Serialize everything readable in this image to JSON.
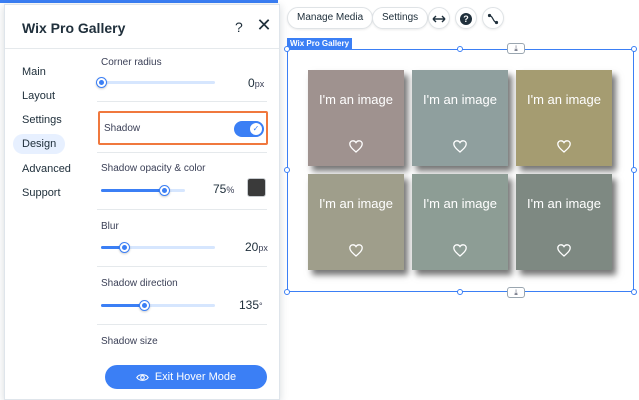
{
  "panel": {
    "title": "Wix Pro Gallery",
    "help_glyph": "?",
    "close_glyph": "✕",
    "nav": [
      {
        "label": "Main",
        "active": false
      },
      {
        "label": "Layout",
        "active": false
      },
      {
        "label": "Settings",
        "active": false
      },
      {
        "label": "Design",
        "active": true
      },
      {
        "label": "Advanced",
        "active": false
      },
      {
        "label": "Support",
        "active": false
      }
    ],
    "corner_radius": {
      "label": "Corner radius",
      "value": "0",
      "unit": "px",
      "fraction": 0.0
    },
    "shadow": {
      "label": "Shadow",
      "enabled": true
    },
    "shadow_opacity": {
      "label": "Shadow opacity & color",
      "value": "75",
      "unit": "%",
      "fraction": 0.75,
      "color": "#3a3a3a"
    },
    "blur": {
      "label": "Blur",
      "value": "20",
      "unit": "px",
      "fraction": 0.2
    },
    "shadow_direction": {
      "label": "Shadow direction",
      "value": "135",
      "unit": "°",
      "fraction": 0.375
    },
    "shadow_size": {
      "label": "Shadow size"
    },
    "exit_button": "Exit Hover Mode"
  },
  "toolbar": {
    "manage_media": "Manage Media",
    "settings": "Settings",
    "stretch_icon": "arrows-horizontal-icon",
    "help_icon": "question-circle-icon",
    "connect_icon": "connect-icon"
  },
  "gallery": {
    "selection_label": "Wix Pro Gallery",
    "items": [
      {
        "title": "I'm an image",
        "bg": "#b79a93"
      },
      {
        "title": "I'm an image",
        "bg": "#93b6b3"
      },
      {
        "title": "I'm an image",
        "bg": "#c4b050"
      },
      {
        "title": "I'm an image",
        "bg": "#b7b48a"
      },
      {
        "title": "I'm an image",
        "bg": "#8fb2a0"
      },
      {
        "title": "I'm an image",
        "bg": "#6e8576"
      }
    ]
  },
  "colors": {
    "accent": "#3b7ff5",
    "highlight": "#f0783e"
  }
}
